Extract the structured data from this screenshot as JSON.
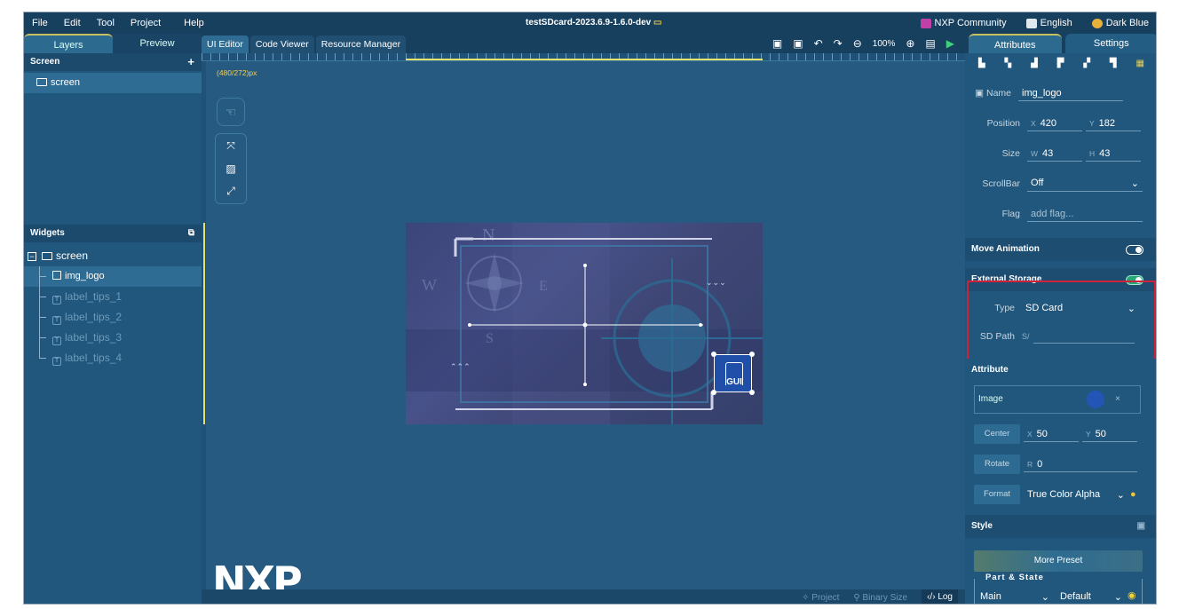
{
  "menu": {
    "items": [
      "File",
      "Edit",
      "Tool",
      "Project",
      "Help"
    ]
  },
  "title": "testSDcard-2023.6.9-1.6.0-dev",
  "menu_right": {
    "community": "NXP Community",
    "language": "English",
    "theme": "Dark Blue"
  },
  "left_tabs": [
    "Layers",
    "Preview"
  ],
  "screen_section": {
    "title": "Screen",
    "add": "+",
    "items": [
      "screen"
    ]
  },
  "widgets_section": {
    "title": "Widgets",
    "root": "screen",
    "items": [
      "img_logo",
      "label_tips_1",
      "label_tips_2",
      "label_tips_3",
      "label_tips_4"
    ]
  },
  "editor_tabs": [
    "UI Editor",
    "Code Viewer",
    "Resource Manager"
  ],
  "zoom": "100%",
  "canvas": {
    "dimension_label": "(480/272)px",
    "logo": "NXP"
  },
  "status_bar": {
    "project": "Project",
    "binary": "Binary Size",
    "log": "Log"
  },
  "preview": {
    "icon_text": "GUI"
  },
  "right_tabs": [
    "Attributes",
    "Settings"
  ],
  "props": {
    "name_label": "Name",
    "name_value": "img_logo",
    "position_label": "Position",
    "x_label": "X",
    "x_value": "420",
    "y_label": "Y",
    "y_value": "182",
    "size_label": "Size",
    "w_label": "W",
    "w_value": "43",
    "h_label": "H",
    "h_value": "43",
    "scrollbar_label": "ScrollBar",
    "scrollbar_value": "Off",
    "flag_label": "Flag",
    "flag_placeholder": "add flag..."
  },
  "move_animation": {
    "title": "Move Animation",
    "state": "OFF"
  },
  "external_storage": {
    "title": "External Storage",
    "state": "ON",
    "type_label": "Type",
    "type_value": "SD Card",
    "path_label": "SD Path",
    "path_prefix": "S/"
  },
  "attribute": {
    "title": "Attribute",
    "image_label": "Image",
    "center_btn": "Center",
    "cx_label": "X",
    "cx_value": "50",
    "cy_label": "Y",
    "cy_value": "50",
    "rotate_btn": "Rotate",
    "r_label": "R",
    "r_value": "0",
    "format_btn": "Format",
    "format_value": "True Color Alpha"
  },
  "style": {
    "title": "Style",
    "preset": "More Preset",
    "part_state": "Part & State",
    "part": "Main",
    "state": "Default"
  },
  "colors": {
    "accent": "#c9c160",
    "highlight_border": "#d0213b",
    "panel": "#21577c",
    "canvas": "#265a80"
  }
}
